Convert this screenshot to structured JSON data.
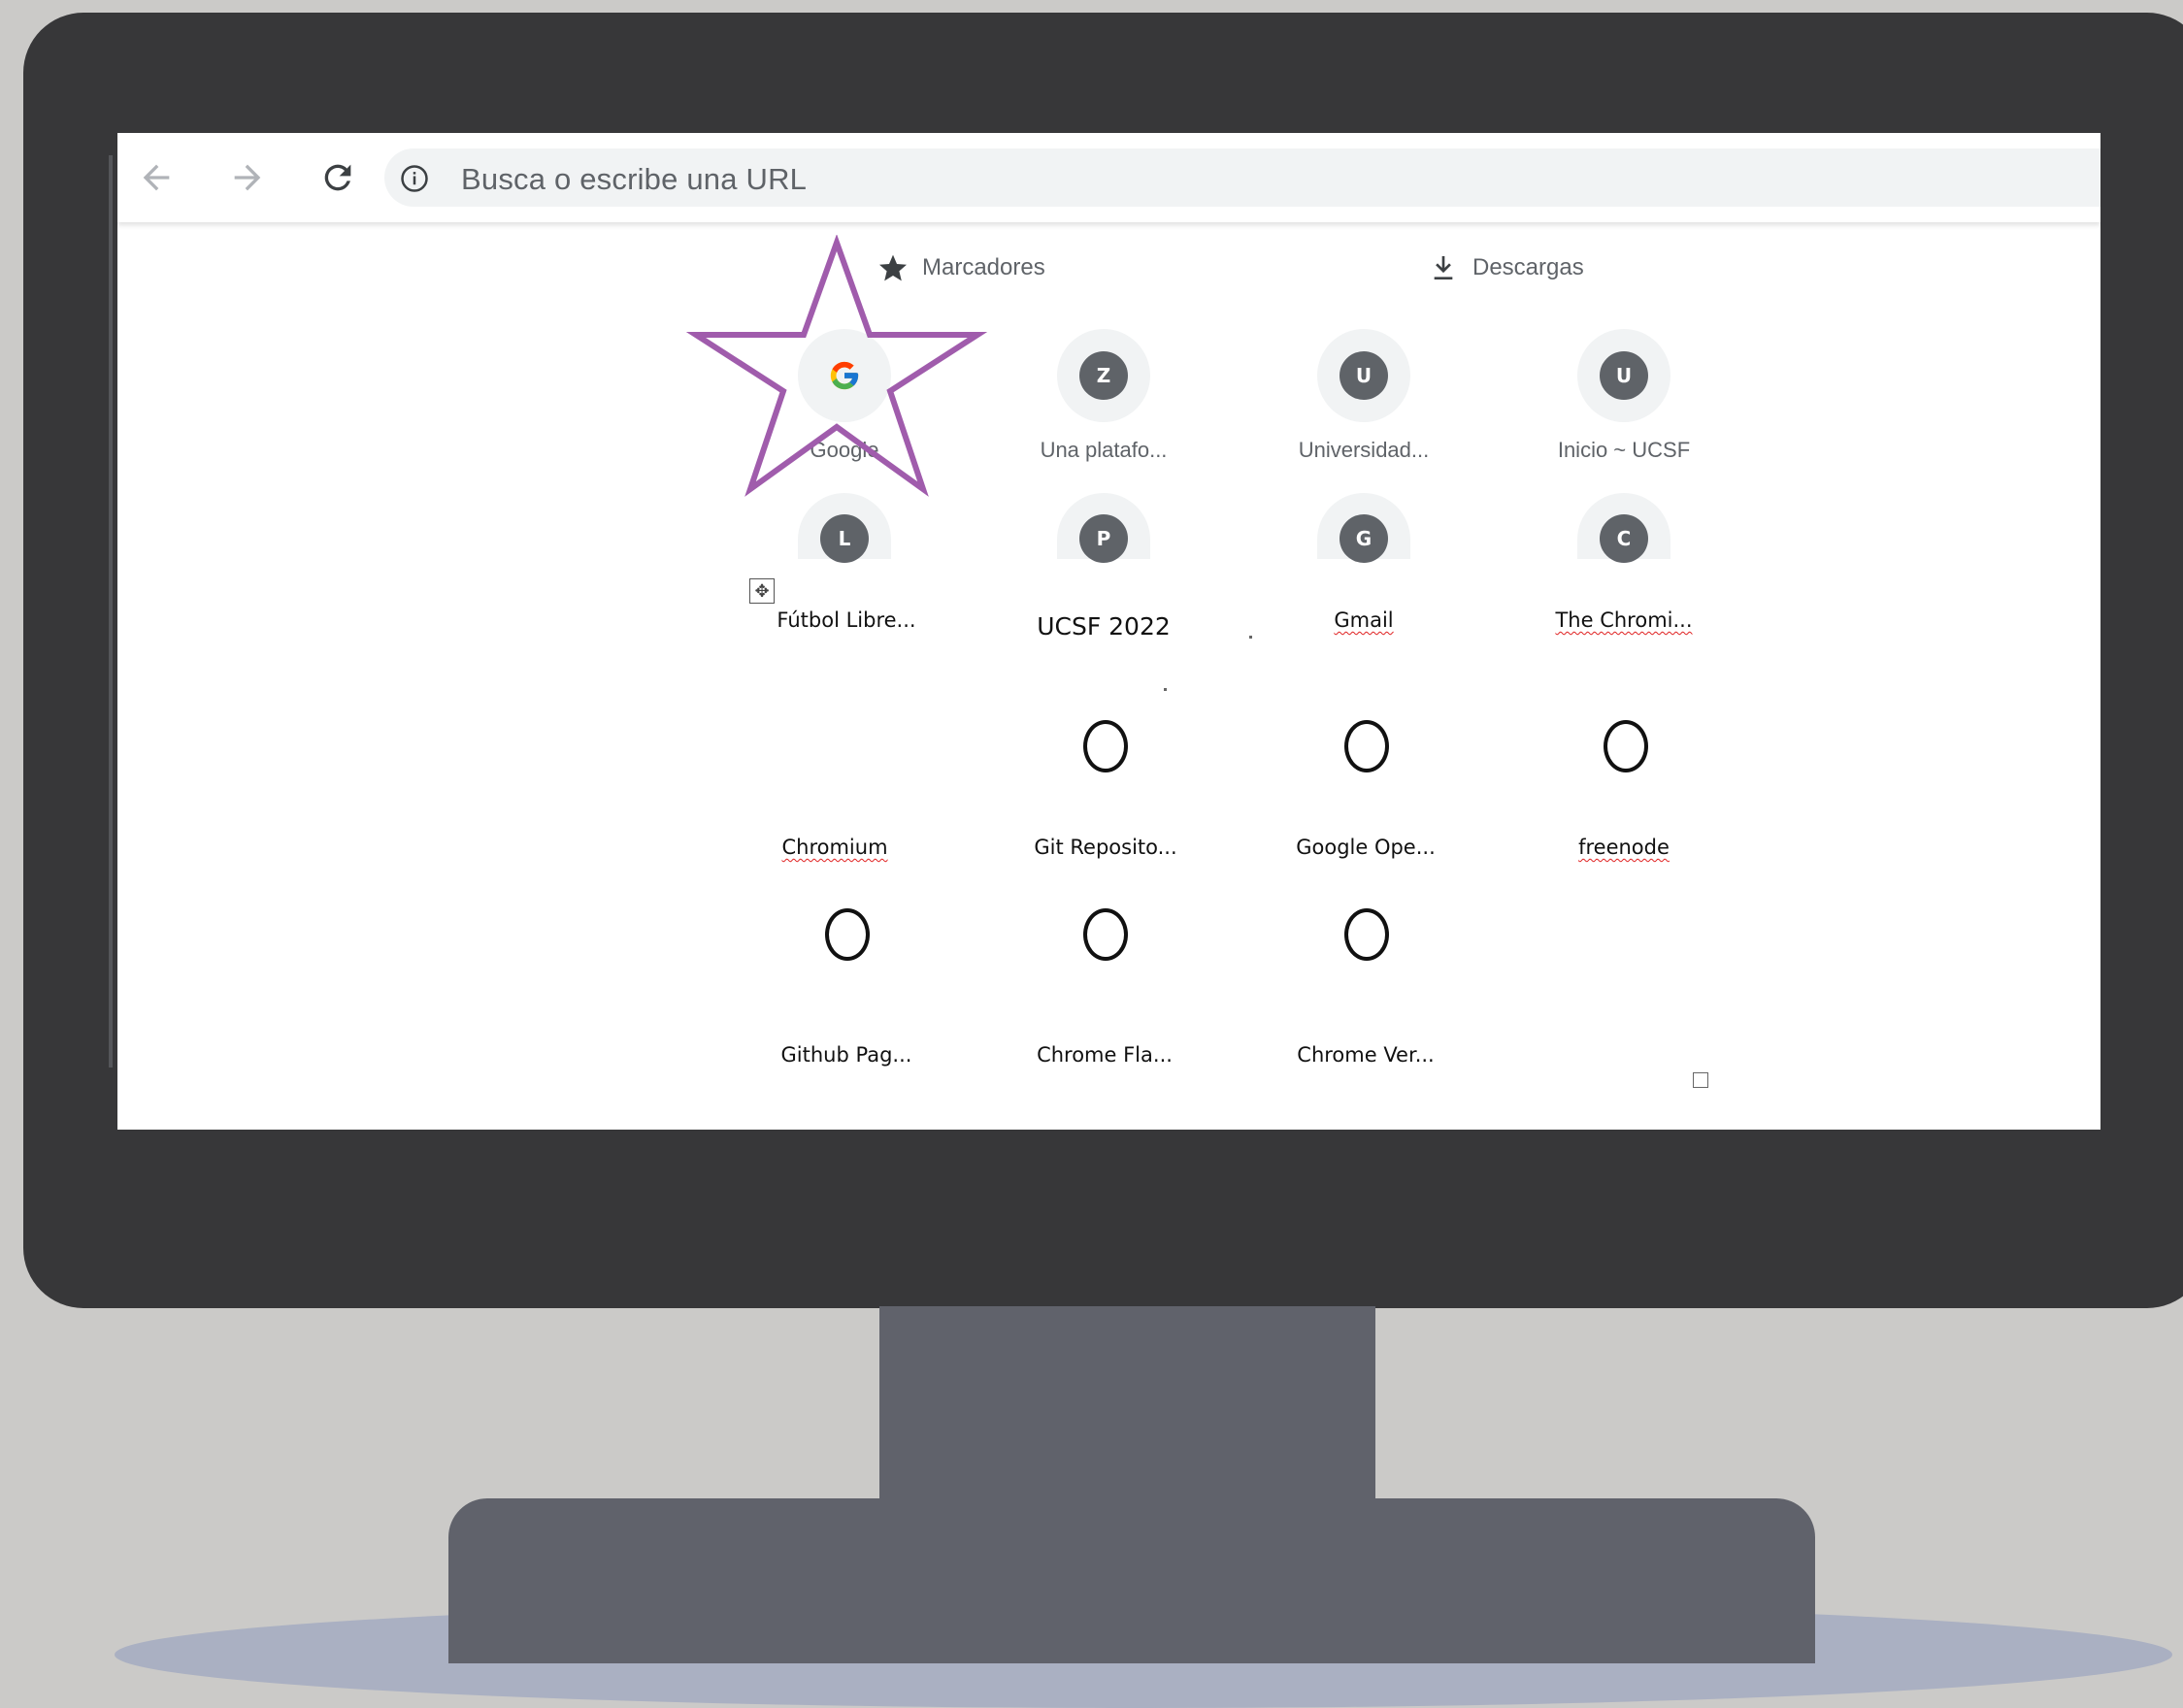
{
  "browser": {
    "omnibox": {
      "placeholder": "Busca o escribe una URL"
    },
    "nav_icons": [
      "back-arrow-icon",
      "forward-arrow-icon",
      "reload-icon",
      "info-icon"
    ]
  },
  "shortcuts_bar": {
    "bookmarks_label": "Marcadores",
    "downloads_label": "Descargas"
  },
  "tiles_row1": [
    {
      "label": "Google",
      "icon": "google-logo-icon"
    },
    {
      "label": "Una platafo...",
      "letter": "Z"
    },
    {
      "label": "Universidad...",
      "letter": "U"
    },
    {
      "label": "Inicio ~ UCSF",
      "letter": "U"
    }
  ],
  "tiles_row2": [
    {
      "letter": "L"
    },
    {
      "letter": "P"
    },
    {
      "letter": "G"
    },
    {
      "letter": "C"
    }
  ],
  "doc_labels_row2": [
    "Fútbol Libre...",
    "UCSF 2022",
    "Gmail",
    "The Chromi..."
  ],
  "doc_labels_row3": [
    "Chromium",
    "Git Reposito...",
    "Google Ope...",
    "freenode"
  ],
  "doc_labels_row4": [
    "Github Pag...",
    "Chrome Fla...",
    "Chrome Ver..."
  ],
  "colors": {
    "annotation_star": "#a05cac",
    "monitor_frame": "#373739",
    "stand": "#60626b",
    "background": "#cbcac8"
  }
}
